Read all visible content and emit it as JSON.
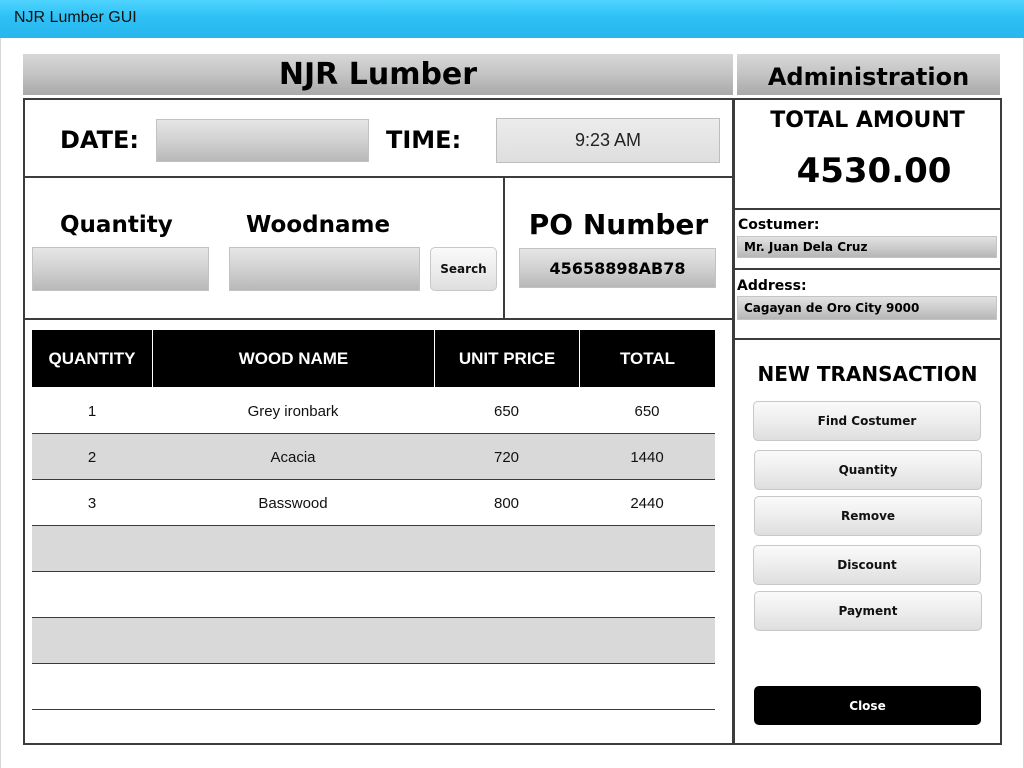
{
  "window": {
    "title": "NJR Lumber GUI"
  },
  "header": {
    "title": "NJR Lumber",
    "side_title": "Administration"
  },
  "datetime": {
    "date_label": "DATE:",
    "date_value": "",
    "time_label": "TIME:",
    "time_value": "9:23 AM"
  },
  "entry": {
    "quantity_label": "Quantity",
    "woodname_label": "Woodname",
    "search_label": "Search"
  },
  "po": {
    "label": "PO Number",
    "value": "45658898AB78"
  },
  "table": {
    "columns": [
      "QUANTITY",
      "WOOD NAME",
      "UNIT PRICE",
      "TOTAL"
    ],
    "rows": [
      {
        "quantity": "1",
        "wood_name": "Grey ironbark",
        "unit_price": "650",
        "total": "650"
      },
      {
        "quantity": "2",
        "wood_name": "Acacia",
        "unit_price": "720",
        "total": "1440"
      },
      {
        "quantity": "3",
        "wood_name": "Basswood",
        "unit_price": "800",
        "total": "2440"
      },
      {
        "quantity": "",
        "wood_name": "",
        "unit_price": "",
        "total": ""
      },
      {
        "quantity": "",
        "wood_name": "",
        "unit_price": "",
        "total": ""
      },
      {
        "quantity": "",
        "wood_name": "",
        "unit_price": "",
        "total": ""
      },
      {
        "quantity": "",
        "wood_name": "",
        "unit_price": "",
        "total": ""
      }
    ]
  },
  "summary": {
    "total_label": "TOTAL AMOUNT",
    "total_value": "4530.00"
  },
  "customer": {
    "label": "Costumer:",
    "value": "Mr. Juan Dela Cruz"
  },
  "address": {
    "label": "Address:",
    "value": "Cagayan de Oro City 9000"
  },
  "transaction": {
    "title": "NEW TRANSACTION",
    "buttons": [
      "Find Costumer",
      "Quantity",
      "Remove",
      "Discount",
      "Payment"
    ],
    "close_label": "Close"
  }
}
